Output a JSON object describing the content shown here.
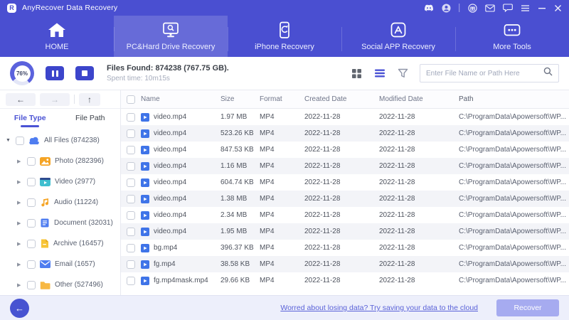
{
  "titlebar": {
    "app_title": "AnyRecover Data Recovery",
    "icons": [
      "discord-icon",
      "account-icon",
      "divider",
      "gift-icon",
      "mail-icon",
      "chat-icon",
      "menu-icon",
      "minimize-icon",
      "close-icon"
    ]
  },
  "nav": {
    "tabs": [
      {
        "label": "HOME",
        "icon": "home-icon",
        "active": false
      },
      {
        "label": "PC&Hard Drive Recovery",
        "icon": "pc-recovery-icon",
        "active": true
      },
      {
        "label": "iPhone Recovery",
        "icon": "iphone-recovery-icon",
        "active": false
      },
      {
        "label": "Social APP Recovery",
        "icon": "social-app-recovery-icon",
        "active": false
      },
      {
        "label": "More Tools",
        "icon": "more-tools-icon",
        "active": false
      }
    ]
  },
  "scan": {
    "progress_percent": "76%",
    "files_found": "Files Found: 874238 (767.75 GB).",
    "spent_time": "Spent time: 10m15s"
  },
  "search": {
    "placeholder": "Enter File Name or Path Here"
  },
  "sidebar": {
    "tabs": [
      {
        "label": "File Type",
        "active": true
      },
      {
        "label": "File Path",
        "active": false
      }
    ],
    "tree": [
      {
        "label": "All Files (874238)",
        "icon": "all-files-icon",
        "root": true,
        "expanded": true
      },
      {
        "label": "Photo (282396)",
        "icon": "photo-icon"
      },
      {
        "label": "Video (2977)",
        "icon": "video-icon"
      },
      {
        "label": "Audio (11224)",
        "icon": "audio-icon"
      },
      {
        "label": "Document (32031)",
        "icon": "document-icon"
      },
      {
        "label": "Archive (16457)",
        "icon": "archive-icon"
      },
      {
        "label": "Email (1657)",
        "icon": "email-icon"
      },
      {
        "label": "Other (527496)",
        "icon": "other-icon"
      }
    ]
  },
  "table": {
    "headers": [
      "Name",
      "Size",
      "Format",
      "Created Date",
      "Modified Date",
      "Path"
    ],
    "rows": [
      {
        "name": "video.mp4",
        "size": "1.97 MB",
        "format": "MP4",
        "created": "2022-11-28",
        "modified": "2022-11-28",
        "path": "C:\\ProgramData\\Apowersoft\\WP..."
      },
      {
        "name": "video.mp4",
        "size": "523.26 KB",
        "format": "MP4",
        "created": "2022-11-28",
        "modified": "2022-11-28",
        "path": "C:\\ProgramData\\Apowersoft\\WP..."
      },
      {
        "name": "video.mp4",
        "size": "847.53 KB",
        "format": "MP4",
        "created": "2022-11-28",
        "modified": "2022-11-28",
        "path": "C:\\ProgramData\\Apowersoft\\WP..."
      },
      {
        "name": "video.mp4",
        "size": "1.16 MB",
        "format": "MP4",
        "created": "2022-11-28",
        "modified": "2022-11-28",
        "path": "C:\\ProgramData\\Apowersoft\\WP..."
      },
      {
        "name": "video.mp4",
        "size": "604.74 KB",
        "format": "MP4",
        "created": "2022-11-28",
        "modified": "2022-11-28",
        "path": "C:\\ProgramData\\Apowersoft\\WP..."
      },
      {
        "name": "video.mp4",
        "size": "1.38 MB",
        "format": "MP4",
        "created": "2022-11-28",
        "modified": "2022-11-28",
        "path": "C:\\ProgramData\\Apowersoft\\WP..."
      },
      {
        "name": "video.mp4",
        "size": "2.34 MB",
        "format": "MP4",
        "created": "2022-11-28",
        "modified": "2022-11-28",
        "path": "C:\\ProgramData\\Apowersoft\\WP..."
      },
      {
        "name": "video.mp4",
        "size": "1.95 MB",
        "format": "MP4",
        "created": "2022-11-28",
        "modified": "2022-11-28",
        "path": "C:\\ProgramData\\Apowersoft\\WP..."
      },
      {
        "name": "bg.mp4",
        "size": "396.37 KB",
        "format": "MP4",
        "created": "2022-11-28",
        "modified": "2022-11-28",
        "path": "C:\\ProgramData\\Apowersoft\\WP..."
      },
      {
        "name": "fg.mp4",
        "size": "38.58 KB",
        "format": "MP4",
        "created": "2022-11-28",
        "modified": "2022-11-28",
        "path": "C:\\ProgramData\\Apowersoft\\WP..."
      },
      {
        "name": "fg.mp4mask.mp4",
        "size": "29.66 KB",
        "format": "MP4",
        "created": "2022-11-28",
        "modified": "2022-11-28",
        "path": "C:\\ProgramData\\Apowersoft\\WP..."
      }
    ]
  },
  "toolbar": {
    "view_icons": [
      "grid-view-icon",
      "list-view-icon",
      "filter-icon"
    ],
    "nav_arrows": [
      "back",
      "forward",
      "up"
    ]
  },
  "footer": {
    "cloud_link": "Worred about losing data? Try saving your data to the cloud",
    "recover_label": "Recover"
  },
  "colors": {
    "primary": "#4a4fd1",
    "accent": "#4a52d4",
    "row_alt": "#f3f4f8",
    "recover_disabled": "#a6abf0",
    "footer_bg": "#edeffb"
  }
}
